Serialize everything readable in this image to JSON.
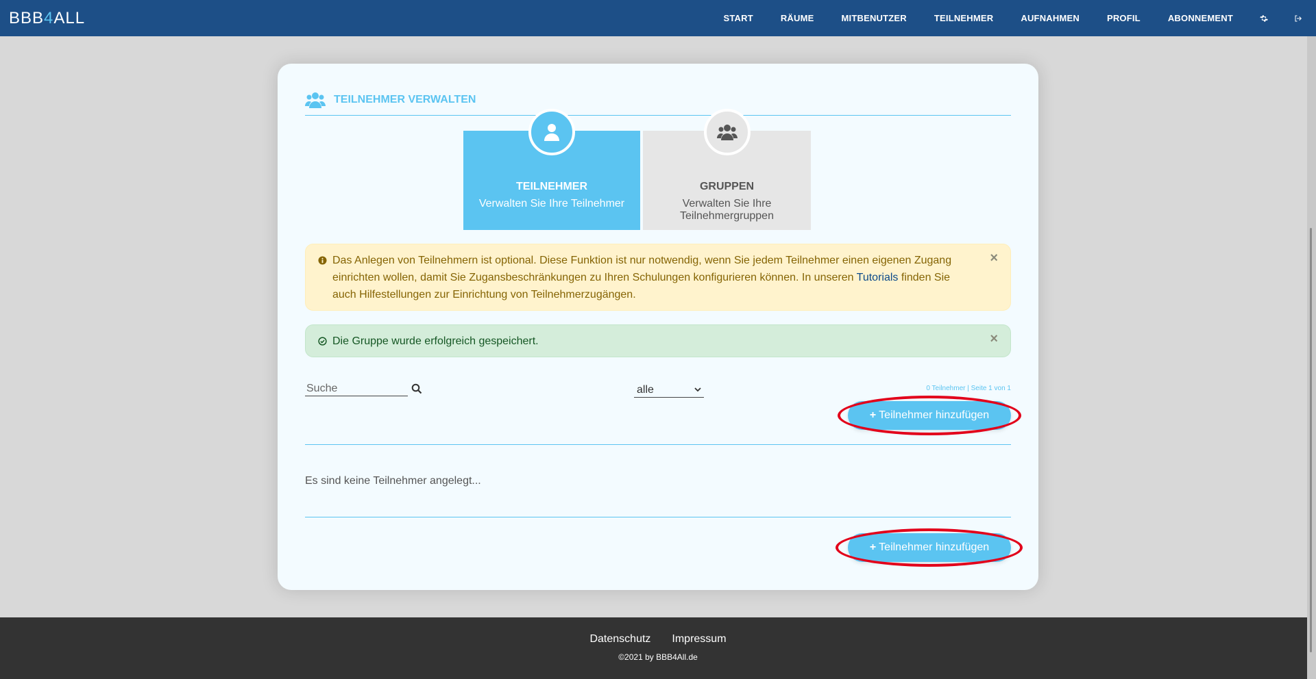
{
  "brand": {
    "logo_part1": "BBB",
    "logo_part2": "4",
    "logo_part3": "ALL"
  },
  "nav": {
    "items": [
      "START",
      "RÄUME",
      "MITBENUTZER",
      "TEILNEHMER",
      "AUFNAHMEN",
      "PROFIL",
      "ABONNEMENT"
    ],
    "icons": [
      "gear-icon",
      "logout-icon"
    ]
  },
  "section": {
    "title": "TEILNEHMER VERWALTEN"
  },
  "tabs": [
    {
      "title": "TEILNEHMER",
      "subtitle": "Verwalten Sie Ihre Teilnehmer",
      "active": true
    },
    {
      "title": "GRUPPEN",
      "subtitle": "Verwalten Sie Ihre Teilnehmergruppen",
      "active": false
    }
  ],
  "alerts": {
    "warning": {
      "text_before": "Das Anlegen von Teilnehmern ist optional. Diese Funktion ist nur notwendig, wenn Sie jedem Teilnehmer einen eigenen Zugang einrichten wollen, damit Sie Zugansbeschränkungen zu Ihren Schulungen konfigurieren können. In unseren ",
      "link_text": "Tutorials",
      "text_after": " finden Sie auch Hilfestellungen zur Einrichtung von Teilnehmerzugängen.",
      "close": "×"
    },
    "success": {
      "text": "Die Gruppe wurde erfolgreich gespeichert.",
      "close": "×"
    }
  },
  "filters": {
    "search_placeholder": "Suche",
    "select_value": "alle",
    "pager_info": "0 Teilnehmer | Seite 1 von 1"
  },
  "actions": {
    "add_label": "Teilnehmer hinzufügen",
    "plus": "+"
  },
  "list": {
    "empty_text": "Es sind keine Teilnehmer angelegt..."
  },
  "footer": {
    "links": [
      "Datenschutz",
      "Impressum"
    ],
    "copyright": "©2021 by BBB4All.de"
  },
  "colors": {
    "nav_bg": "#1d4f87",
    "accent": "#5bc4f1",
    "highlight_ring": "#e2001a"
  }
}
